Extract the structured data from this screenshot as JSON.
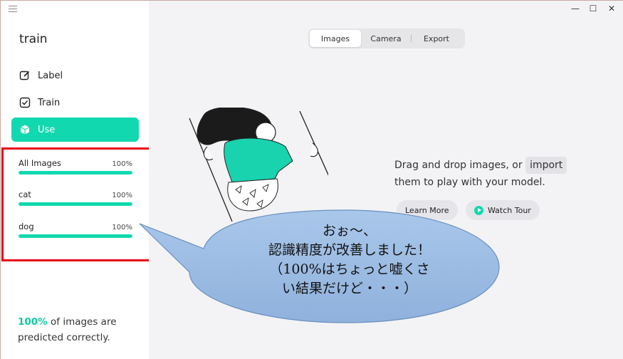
{
  "app": {
    "title": "train"
  },
  "nav": [
    {
      "label": "Label",
      "icon": "edit-icon"
    },
    {
      "label": "Train",
      "icon": "checkbox-icon"
    },
    {
      "label": "Use",
      "icon": "cube-icon"
    }
  ],
  "classes": [
    {
      "name": "All Images",
      "percent": "100%",
      "fill": 1.0
    },
    {
      "name": "cat",
      "percent": "100%",
      "fill": 1.0
    },
    {
      "name": "dog",
      "percent": "100%",
      "fill": 1.0
    }
  ],
  "summary": {
    "pct": "100%",
    "text1": " of images are",
    "text2": "predicted correctly."
  },
  "tabs": [
    {
      "label": "Images",
      "active": true
    },
    {
      "label": "Camera",
      "active": false
    },
    {
      "label": "Export",
      "active": false
    }
  ],
  "dropzone": {
    "line1_pre": "Drag and drop images, or ",
    "import": "import",
    "line2": "them to play with your model."
  },
  "buttons": {
    "learn_more": "Learn More",
    "watch_tour": "Watch Tour"
  },
  "callout": {
    "lines": [
      "おぉ～、",
      "認識精度が改善しました！",
      "（100%はちょっと嘘くさ",
      "い結果だけど・・・）"
    ]
  },
  "colors": {
    "accent": "#12d8b0",
    "highlight_box": "#e8001a",
    "callout_fill": "#9bbde3"
  }
}
